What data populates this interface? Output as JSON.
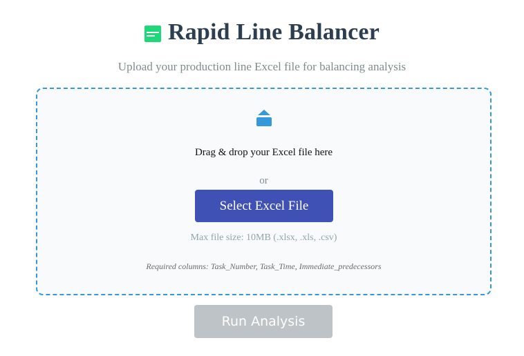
{
  "header": {
    "title": "Rapid Line Balancer",
    "logo_icon": "spreadsheet-icon",
    "logo_color": "#1fd87a",
    "title_color": "#2c3e50"
  },
  "subtitle": "Upload your production line Excel file for balancing analysis",
  "dropzone": {
    "icon": "eject-upload-icon",
    "icon_color": "#3498db",
    "border_color": "#3498db",
    "drag_text": "Drag & drop your Excel file here",
    "or_text": "or",
    "select_button_label": "Select Excel File",
    "select_button_color": "#3f51b5",
    "max_size_text": "Max file size: 10MB (.xlsx, .xls, .csv)",
    "required_columns_text": "Required columns: Task_Number, Task_Time, Immediate_predecessors"
  },
  "actions": {
    "run_button_label": "Run Analysis",
    "run_button_color": "#bdc3c7",
    "run_button_disabled": true
  }
}
